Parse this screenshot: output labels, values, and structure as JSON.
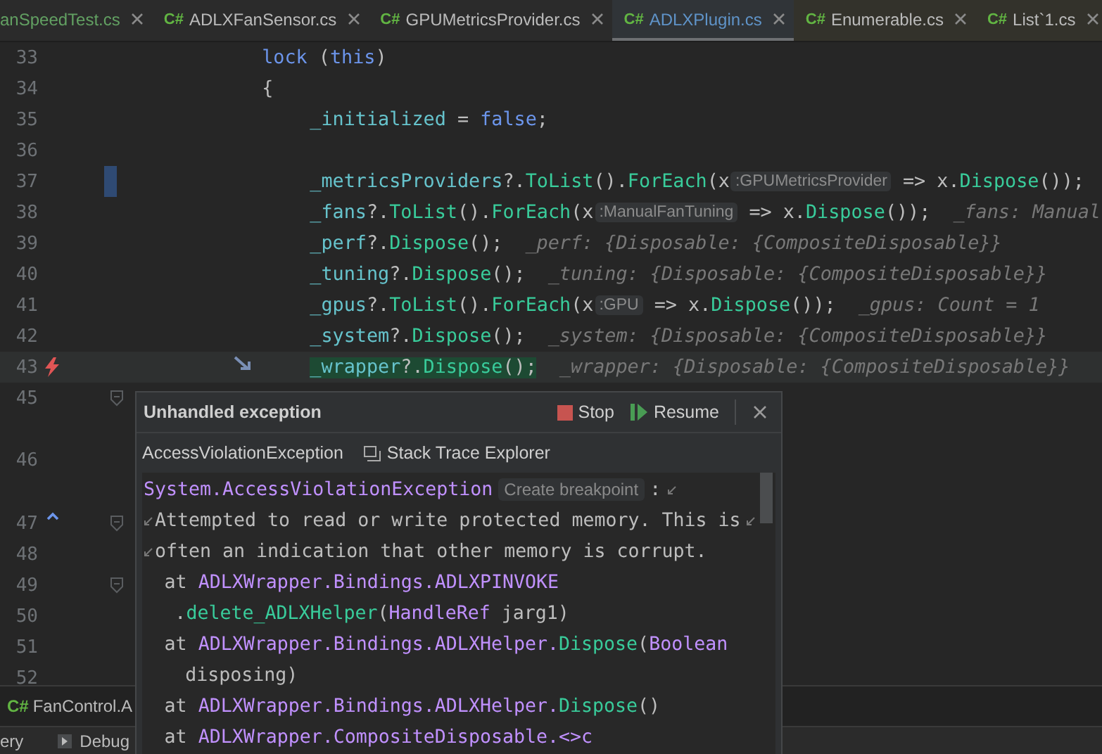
{
  "tabs": [
    {
      "label": "anSpeedTest.cs",
      "kind": "test",
      "selected": false
    },
    {
      "badge": "C#",
      "label": "ADLXFanSensor.cs",
      "kind": "project",
      "selected": false
    },
    {
      "badge": "C#",
      "label": "GPUMetricsProvider.cs",
      "kind": "project",
      "selected": false
    },
    {
      "badge": "C#",
      "label": "ADLXPlugin.cs",
      "kind": "project",
      "selected": true
    },
    {
      "badge": "C#",
      "label": "Enumerable.cs",
      "kind": "library",
      "selected": false
    },
    {
      "badge": "C#",
      "label": "List`1.cs",
      "kind": "library",
      "selected": false
    }
  ],
  "editor": {
    "lines": [
      {
        "number": "33",
        "kind": "outer",
        "parts": [
          {
            "kind": "code",
            "tokens": [
              {
                "kind": "keyword",
                "text": "lock"
              },
              {
                "kind": "plain",
                "text": " ("
              },
              {
                "kind": "keyword",
                "text": "this"
              },
              {
                "kind": "plain",
                "text": ")"
              }
            ]
          }
        ]
      },
      {
        "number": "34",
        "kind": "outer",
        "parts": [
          {
            "kind": "code",
            "tokens": [
              {
                "kind": "plain",
                "text": "{"
              }
            ]
          }
        ]
      },
      {
        "number": "35",
        "kind": "inner",
        "parts": [
          {
            "kind": "code",
            "tokens": [
              {
                "kind": "field",
                "text": "_initialized"
              },
              {
                "kind": "plain",
                "text": " = "
              },
              {
                "kind": "keyword",
                "text": "false"
              },
              {
                "kind": "plain",
                "text": ";"
              }
            ]
          }
        ]
      },
      {
        "number": "36"
      },
      {
        "number": "37",
        "kind": "inner",
        "modified": true,
        "parts": [
          {
            "kind": "code",
            "tokens": [
              {
                "kind": "field",
                "text": "_metricsProviders"
              },
              {
                "kind": "plain",
                "text": "?."
              },
              {
                "kind": "method",
                "text": "ToList"
              },
              {
                "kind": "plain",
                "text": "()."
              },
              {
                "kind": "method",
                "text": "ForEach"
              },
              {
                "kind": "plain",
                "text": "(x"
              }
            ]
          },
          {
            "kind": "hint",
            "text": ":GPUMetricsProvider"
          },
          {
            "kind": "code",
            "tokens": [
              {
                "kind": "plain",
                "text": "=> x."
              },
              {
                "kind": "method",
                "text": "Dispose"
              },
              {
                "kind": "plain",
                "text": "());"
              }
            ]
          }
        ]
      },
      {
        "number": "38",
        "kind": "inner",
        "parts": [
          {
            "kind": "code",
            "tokens": [
              {
                "kind": "field",
                "text": "_fans"
              },
              {
                "kind": "plain",
                "text": "?."
              },
              {
                "kind": "method",
                "text": "ToList"
              },
              {
                "kind": "plain",
                "text": "()."
              },
              {
                "kind": "method",
                "text": "ForEach"
              },
              {
                "kind": "plain",
                "text": "(x"
              }
            ]
          },
          {
            "kind": "hint",
            "text": ":ManualFanTuning"
          },
          {
            "kind": "code",
            "tokens": [
              {
                "kind": "plain",
                "text": "=> x."
              },
              {
                "kind": "method",
                "text": "Dispose"
              },
              {
                "kind": "plain",
                "text": "());"
              }
            ]
          },
          {
            "kind": "value",
            "text": "_fans: Manual"
          }
        ]
      },
      {
        "number": "39",
        "kind": "inner",
        "parts": [
          {
            "kind": "code",
            "tokens": [
              {
                "kind": "field",
                "text": "_perf"
              },
              {
                "kind": "plain",
                "text": "?."
              },
              {
                "kind": "method",
                "text": "Dispose"
              },
              {
                "kind": "plain",
                "text": "();"
              }
            ]
          },
          {
            "kind": "value",
            "text": "_perf: {Disposable: {CompositeDisposable}}"
          }
        ]
      },
      {
        "number": "40",
        "kind": "inner",
        "parts": [
          {
            "kind": "code",
            "tokens": [
              {
                "kind": "field",
                "text": "_tuning"
              },
              {
                "kind": "plain",
                "text": "?."
              },
              {
                "kind": "method",
                "text": "Dispose"
              },
              {
                "kind": "plain",
                "text": "();"
              }
            ]
          },
          {
            "kind": "value",
            "text": "_tuning: {Disposable: {CompositeDisposable}}"
          }
        ]
      },
      {
        "number": "41",
        "kind": "inner",
        "parts": [
          {
            "kind": "code",
            "tokens": [
              {
                "kind": "field",
                "text": "_gpus"
              },
              {
                "kind": "plain",
                "text": "?."
              },
              {
                "kind": "method",
                "text": "ToList"
              },
              {
                "kind": "plain",
                "text": "()."
              },
              {
                "kind": "method",
                "text": "ForEach"
              },
              {
                "kind": "plain",
                "text": "(x"
              }
            ]
          },
          {
            "kind": "hint",
            "text": ":GPU"
          },
          {
            "kind": "code",
            "tokens": [
              {
                "kind": "plain",
                "text": "=> x."
              },
              {
                "kind": "method",
                "text": "Dispose"
              },
              {
                "kind": "plain",
                "text": "());"
              }
            ]
          },
          {
            "kind": "value",
            "text": "_gpus: Count = 1"
          }
        ]
      },
      {
        "number": "42",
        "kind": "inner",
        "parts": [
          {
            "kind": "code",
            "tokens": [
              {
                "kind": "field",
                "text": "_system"
              },
              {
                "kind": "plain",
                "text": "?."
              },
              {
                "kind": "method",
                "text": "Dispose"
              },
              {
                "kind": "plain",
                "text": "();"
              }
            ]
          },
          {
            "kind": "value",
            "text": "_system: {Disposable: {CompositeDisposable}}"
          }
        ]
      },
      {
        "number": "43",
        "kind": "inner",
        "current": true,
        "exception": true,
        "pointer": true,
        "parts": [
          {
            "kind": "code",
            "highlighted": true,
            "tokens": [
              {
                "kind": "field",
                "text": "_wrapper"
              },
              {
                "kind": "plain",
                "text": "?."
              },
              {
                "kind": "method",
                "text": "Dispose"
              },
              {
                "kind": "plain",
                "text": "();"
              }
            ]
          },
          {
            "kind": "value",
            "text": "_wrapper: {Disposable: {CompositeDisposable}}"
          }
        ]
      },
      {
        "number": "45",
        "foldable": true
      },
      {
        "number": "46"
      },
      {
        "number": "47",
        "foldable": true,
        "navigation": true
      },
      {
        "number": "48"
      },
      {
        "number": "49",
        "foldable": true
      },
      {
        "number": "50"
      },
      {
        "number": "51"
      },
      {
        "number": "52"
      }
    ]
  },
  "exception_popup": {
    "title": "Unhandled exception",
    "buttons": [
      {
        "label": "Stop",
        "kind": "stop"
      },
      {
        "label": "Resume",
        "kind": "resume"
      }
    ],
    "exception_type": "AccessViolationException",
    "stack_trace_link": "Stack Trace Explorer",
    "message_lines": [
      {
        "kind": "message",
        "wrap_end": true,
        "parts": [
          {
            "kind": "code",
            "tokens": [
              {
                "kind": "type",
                "text": "System.AccessViolationException"
              }
            ]
          },
          {
            "kind": "badge",
            "text": "Create breakpoint"
          },
          {
            "kind": "code",
            "tokens": [
              {
                "kind": "plain",
                "text": ":"
              }
            ]
          }
        ]
      },
      {
        "kind": "message",
        "wrap_start": true,
        "wrap_end": true,
        "parts": [
          {
            "kind": "code",
            "tokens": [
              {
                "kind": "plain",
                "text": "Attempted to read or write protected memory. This is"
              }
            ]
          }
        ]
      },
      {
        "kind": "message",
        "wrap_start": true,
        "parts": [
          {
            "kind": "code",
            "tokens": [
              {
                "kind": "plain",
                "text": "often an indication that other memory is corrupt."
              }
            ]
          }
        ]
      },
      {
        "kind": "frame",
        "parts": [
          {
            "kind": "code",
            "tokens": [
              {
                "kind": "plain",
                "text": "at "
              },
              {
                "kind": "type",
                "text": "ADLXWrapper.Bindings.ADLXPINVOKE"
              }
            ]
          }
        ]
      },
      {
        "kind": "frame_continued",
        "parts": [
          {
            "kind": "code",
            "tokens": [
              {
                "kind": "plain",
                "text": "."
              },
              {
                "kind": "method",
                "text": "delete_ADLXHelper"
              },
              {
                "kind": "plain",
                "text": "("
              },
              {
                "kind": "type",
                "text": "HandleRef"
              },
              {
                "kind": "plain",
                "text": " jarg1)"
              }
            ]
          }
        ]
      },
      {
        "kind": "frame",
        "parts": [
          {
            "kind": "code",
            "tokens": [
              {
                "kind": "plain",
                "text": "at "
              },
              {
                "kind": "type",
                "text": "ADLXWrapper.Bindings.ADLXHelper."
              },
              {
                "kind": "method",
                "text": "Dispose"
              },
              {
                "kind": "plain",
                "text": "("
              },
              {
                "kind": "type",
                "text": "Boolean"
              }
            ]
          }
        ]
      },
      {
        "kind": "argument_continued",
        "parts": [
          {
            "kind": "code",
            "tokens": [
              {
                "kind": "plain",
                "text": "disposing)"
              }
            ]
          }
        ]
      },
      {
        "kind": "frame",
        "parts": [
          {
            "kind": "code",
            "tokens": [
              {
                "kind": "plain",
                "text": "at "
              },
              {
                "kind": "type",
                "text": "ADLXWrapper.Bindings.ADLXHelper."
              },
              {
                "kind": "method",
                "text": "Dispose"
              },
              {
                "kind": "plain",
                "text": "()"
              }
            ]
          }
        ]
      },
      {
        "kind": "frame",
        "parts": [
          {
            "kind": "code",
            "tokens": [
              {
                "kind": "plain",
                "text": "at "
              },
              {
                "kind": "type",
                "text": "ADLXWrapper.CompositeDisposable.<>c"
              }
            ]
          }
        ]
      }
    ]
  },
  "bottom_panel": {
    "badge": "C#",
    "item": "FanControl.A",
    "toolbar": [
      "ery",
      "Debug"
    ]
  }
}
